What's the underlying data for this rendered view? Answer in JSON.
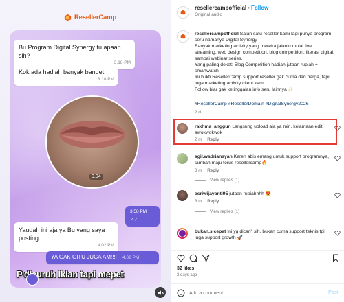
{
  "media": {
    "brand": "ResellerCamp",
    "messages": [
      {
        "text": "Bu Program Digital Synergy tu apaan sih?",
        "time": "3.18 PM"
      },
      {
        "text": "Kok ada hadiah banyak banget",
        "time": "3.18 PM"
      },
      {
        "text": "Yaudah ini aja ya Bu yang saya posting",
        "time": "4.02 PM"
      },
      {
        "text": "YA GAK GITU JUGA AM!!!!",
        "time": "4.02 PM"
      }
    ],
    "video_duration": "0.04",
    "video_sent_time": "3.58 PM",
    "caption": "P disuruh iklan tapi mepet"
  },
  "header": {
    "username": "resellercampofficial",
    "dot": "•",
    "follow": "Follow",
    "audio": "Original audio"
  },
  "post": {
    "username": "resellercampofficial",
    "lines": [
      "Salah satu reseller kami lagi punya program",
      "seru namanya Digital Synergy",
      "Banyak marketing activity yang mereka jalanin mulai live",
      "streaming, web design competition, blog competition, literasi digital,",
      "sampai webinar series.",
      "Yang paling dekat: Blog Competition hadiah jutaan rupiah +",
      "smartwatch!",
      "Ini bukti ResellerCamp support reseller gak cuma dari harga, tapi",
      "juga marketing activity client kami",
      "Follow biar gak ketinggalan info seru lainnya ✨"
    ],
    "hashtags": "#ResellerCamp #ResellerDomain #DigitalSynergy2026",
    "time_ago": "2 d"
  },
  "comments": [
    {
      "username": "rakhma_anggun",
      "text": "Langsung upload aja ya min, kelamaan edit awokwokwok",
      "time": "2 m",
      "reply": "Reply",
      "view_replies": "",
      "avatar_color": "#8d6e63"
    },
    {
      "username": "agil.wadriansyah",
      "text": "Keren abis emang untuk support programnya, tambah maju terus resellercamp🔥",
      "time": "3 m",
      "reply": "Reply",
      "view_replies": "View replies (1)",
      "avatar_color": "#b8c7a1"
    },
    {
      "username": "asriwijayanti95",
      "text": "jutaan rupiahhhh 😍",
      "time": "3 m",
      "reply": "Reply",
      "view_replies": "View replies (1)",
      "avatar_color": "#4e342e"
    },
    {
      "username": "bukan.sicepat",
      "text": "Ini yg dicari\" sih, bukan cuma support teknis tpi juga support growth 🚀",
      "time": "",
      "reply": "",
      "view_replies": "",
      "avatar_color": "#7b1fa2"
    }
  ],
  "stats": {
    "likes": "32 likes",
    "time_ago": "2 days ago"
  },
  "comment_box": {
    "placeholder": "Add a comment…",
    "post_label": "Post"
  },
  "colors": {
    "accent": "#0095f6",
    "brand": "#e8590c",
    "highlight": "#e53935"
  }
}
